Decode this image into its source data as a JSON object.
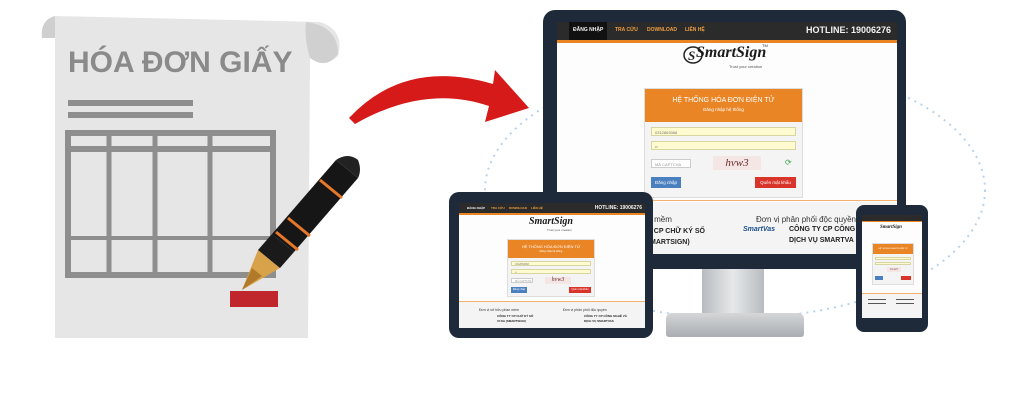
{
  "paper": {
    "title": "HÓA ĐƠN GIẤY"
  },
  "colors": {
    "accent": "#e98524",
    "arrow": "#d61a1a",
    "device": "#1e2a3a",
    "paper": "#e6e6e6",
    "pen": "#161616",
    "stamp": "#c0272d"
  },
  "icons": {
    "document": "paper-invoice-icon",
    "pen": "fountain-pen-icon",
    "arrow": "curved-arrow-icon",
    "refresh": "refresh-icon"
  },
  "monitor": {
    "nav": [
      "ĐĂNG NHẬP",
      "TRA CỨU",
      "DOWNLOAD",
      "LIÊN HỆ"
    ],
    "hotline": "HOTLINE: 19006276",
    "logo": "SmartSign",
    "logo_tm": "TM",
    "tagline": "Trust your creation",
    "login_title": "HỆ THỐNG HÓA ĐƠN ĐIỆN TỬ",
    "login_subtitle": "Đăng nhập hệ thống",
    "username_value": "0312863068",
    "password_value": "••",
    "captcha_placeholder": "MÃ CAPTCHA",
    "captcha_text": "hvw3",
    "login_button": "Đăng nhập",
    "forgot_button": "Quên mật khẩu",
    "footer_left_1": "ần mềm",
    "footer_left_2": "TY CP CHỮ KÝ SỐ",
    "footer_left_3": "(SMARTSIGN)",
    "footer_right_1": "Đơn vị phân phối độc quyền",
    "footer_right_2": "CÔNG TY CP CÔNG NG",
    "footer_right_3": "DỊCH VỤ SMARTVA",
    "footer_logo": "SmartVas"
  },
  "tablet": {
    "nav": [
      "ĐĂNG NHẬP",
      "TRA CỨU",
      "DOWNLOAD",
      "LIÊN HỆ"
    ],
    "hotline": "HOTLINE: 19006276",
    "logo": "SmartSign",
    "tagline": "Trust your creation",
    "login_title": "HỆ THỐNG HÓA ĐƠN ĐIỆN TỬ",
    "login_subtitle": "Đăng nhập hệ thống",
    "username_value": "0312863068",
    "password_value": "••",
    "captcha_placeholder": "MÃ CAPTCHA",
    "captcha_text": "hvw3",
    "login_button": "Đăng nhập",
    "forgot_button": "Quên mật khẩu",
    "footer_left_1": "Đơn vị sở hữu phần mềm",
    "footer_left_2": "CÔNG TY CP CHỮ KÝ SỐ",
    "footer_left_3": "VI NA (SMARTSIGN)",
    "footer_right_1": "Đơn vị phân phối độc quyền",
    "footer_right_2": "CÔNG TY CP CÔNG NGHỆ VÀ",
    "footer_right_3": "DỊCH VỤ SMARTVAS"
  },
  "phone": {
    "logo": "SmartSign",
    "login_title": "HỆ THỐNG HÓA ĐƠN ĐIỆN TỬ",
    "captcha_text": "hvw3"
  }
}
